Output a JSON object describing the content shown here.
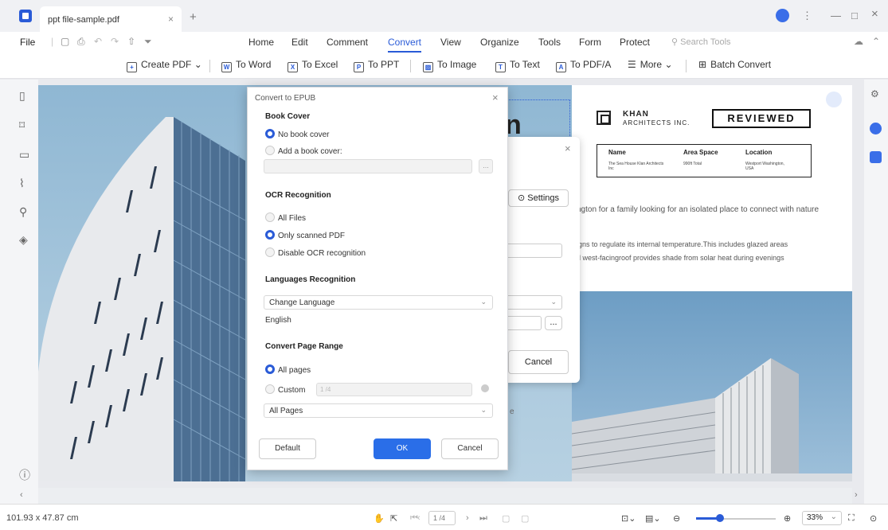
{
  "window": {
    "tab_title": "ppt file-sample.pdf",
    "tab_close": "×",
    "new_tab": "+",
    "more_menu": "⋮",
    "minimize": "—",
    "maximize": "□",
    "close": "×"
  },
  "menubar": {
    "file": "File",
    "items": [
      "Home",
      "Edit",
      "Comment",
      "Convert",
      "View",
      "Organize",
      "Tools",
      "Form",
      "Protect"
    ],
    "active": "Convert",
    "search_placeholder": "Search Tools"
  },
  "ribbon": {
    "create_pdf": "Create PDF",
    "to_word": "To Word",
    "to_excel": "To Excel",
    "to_ppt": "To PPT",
    "to_image": "To Image",
    "to_text": "To Text",
    "to_pdfa": "To PDF/A",
    "more": "More",
    "batch_convert": "Batch Convert"
  },
  "document": {
    "heading_fragment": "n",
    "logo_name": "KHAN",
    "logo_sub": "ARCHITECTS INC.",
    "stamp": "REVIEWED",
    "table": {
      "headers": [
        "Name",
        "Area Space",
        "Location"
      ],
      "values": [
        "The Sea House Klan Architects Inc",
        "990ft Total",
        "Westport Washington, USA"
      ]
    },
    "line1": "ngton for a family looking for an isolated place to connect with nature",
    "line2": "igns to regulate its internal temperature.This includes glazed areas",
    "line3": "d west-facingroof provides shade from solar heat during evenings",
    "fragment_e": "e"
  },
  "background_dialog": {
    "settings": "Settings",
    "cancel": "Cancel",
    "browse": "...",
    "close": "×"
  },
  "dialog": {
    "title": "Convert to EPUB",
    "close": "×",
    "book_cover": {
      "heading": "Book Cover",
      "no_cover": "No book cover",
      "add_cover": "Add a book cover:",
      "browse": "..."
    },
    "ocr": {
      "heading": "OCR Recognition",
      "all_files": "All Files",
      "only_scanned": "Only scanned PDF",
      "disable": "Disable OCR recognition"
    },
    "languages": {
      "heading": "Languages Recognition",
      "dropdown": "Change Language",
      "selected": "English"
    },
    "page_range": {
      "heading": "Convert Page Range",
      "all_pages": "All pages",
      "custom": "Custom",
      "custom_placeholder": "1 /4",
      "dropdown": "All Pages"
    },
    "buttons": {
      "default": "Default",
      "ok": "OK",
      "cancel": "Cancel"
    }
  },
  "statusbar": {
    "dimensions": "101.93 x 47.87 cm",
    "page_indicator": "1 /4",
    "zoom_value": "33%",
    "zoom_fraction": 0.3
  },
  "colors": {
    "accent": "#2a5bd7",
    "ok_button": "#2a6ee8"
  }
}
